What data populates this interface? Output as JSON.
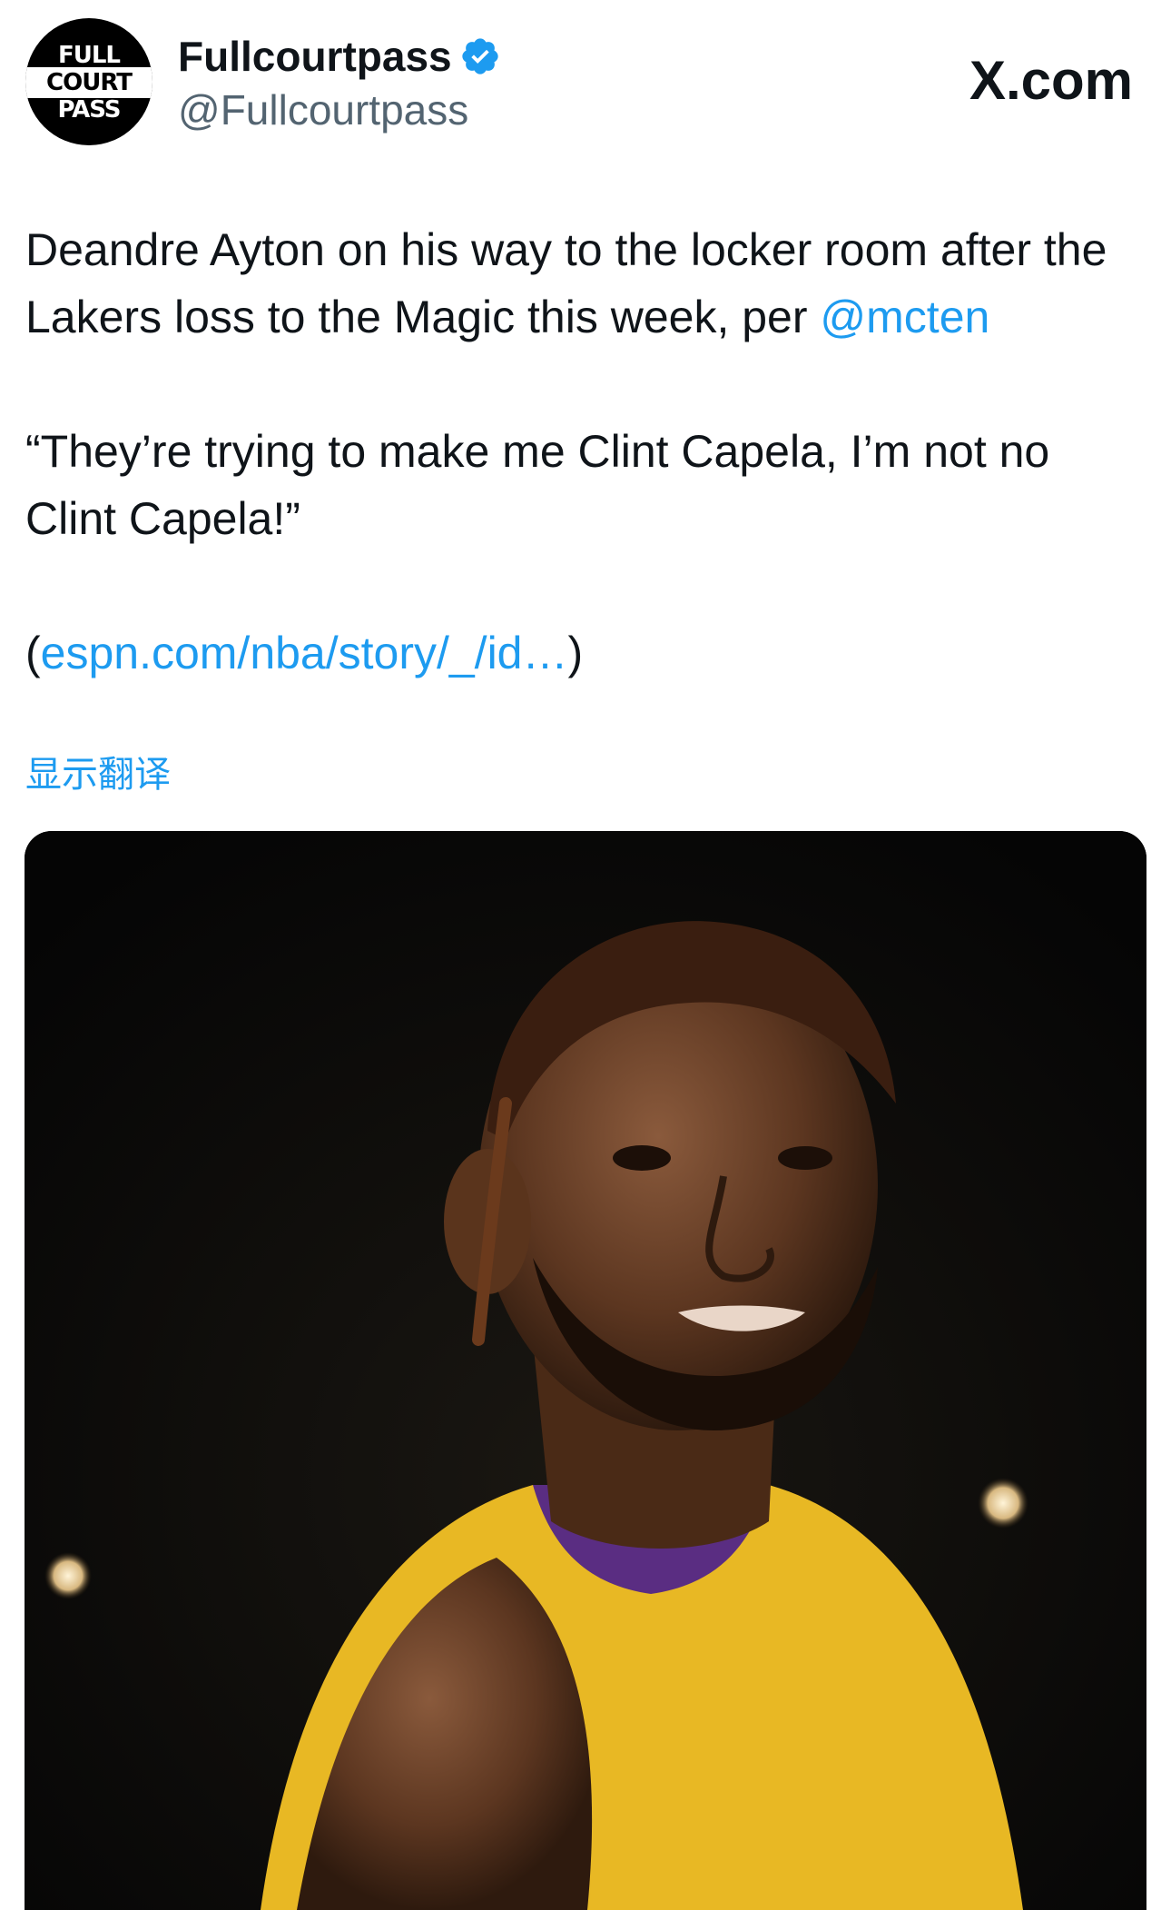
{
  "header": {
    "avatar": {
      "lines": [
        "FULL",
        "COURT",
        "PASS"
      ]
    },
    "display_name": "Fullcourtpass",
    "handle": "@Fullcourtpass",
    "verified": true,
    "brand": "X.com"
  },
  "tweet": {
    "line1_text": "Deandre Ayton on his way to the locker room after the Lakers loss to the Magic this week, per ",
    "mention": "@mcten",
    "quote": "“They’re trying to make me Clint Capela, I’m not no Clint Capela!”",
    "link_open": "(",
    "link_text": "espn.com/nba/story/_/id…",
    "link_close": ")",
    "translate_label": "显示翻译"
  },
  "colors": {
    "text": "#0f1419",
    "secondary": "#536471",
    "link": "#1d9bf0",
    "verified": "#1d9bf0"
  },
  "media": {
    "icon": "photo-of-basketball-player"
  }
}
